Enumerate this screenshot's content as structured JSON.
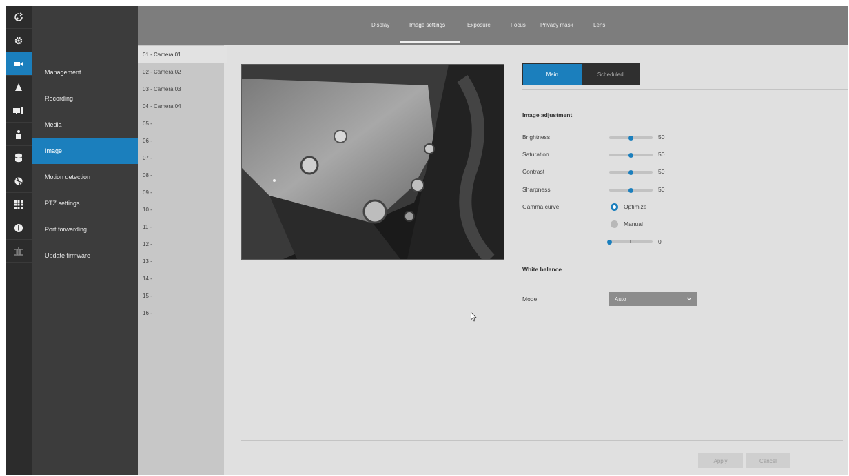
{
  "rail": {
    "items": [
      {
        "icon": "logout-icon"
      },
      {
        "icon": "gear-icon"
      },
      {
        "icon": "camera-icon",
        "active": true
      },
      {
        "icon": "alarm-icon"
      },
      {
        "icon": "monitor-icon"
      },
      {
        "icon": "user-icon"
      },
      {
        "icon": "database-icon"
      },
      {
        "icon": "network-icon"
      },
      {
        "icon": "grid-icon"
      },
      {
        "icon": "info-icon"
      },
      {
        "icon": "keyboard-icon"
      }
    ]
  },
  "menu": {
    "items": [
      {
        "label": "Management"
      },
      {
        "label": "Recording"
      },
      {
        "label": "Media"
      },
      {
        "label": "Image",
        "active": true
      },
      {
        "label": "Motion detection"
      },
      {
        "label": "PTZ settings"
      },
      {
        "label": "Port forwarding"
      },
      {
        "label": "Update firmware"
      }
    ]
  },
  "tabs": {
    "items": [
      {
        "label": "Display"
      },
      {
        "label": "Image settings",
        "active": true
      },
      {
        "label": "Exposure"
      },
      {
        "label": "Focus"
      },
      {
        "label": "Privacy mask"
      },
      {
        "label": "Lens"
      }
    ]
  },
  "cameras": {
    "items": [
      {
        "label": "01 - Camera 01",
        "active": true
      },
      {
        "label": "02 - Camera 02"
      },
      {
        "label": "03 - Camera 03"
      },
      {
        "label": "04 - Camera 04"
      },
      {
        "label": "05 -"
      },
      {
        "label": "06 -"
      },
      {
        "label": "07 -"
      },
      {
        "label": "08 -"
      },
      {
        "label": "09 -"
      },
      {
        "label": "10 -"
      },
      {
        "label": "11 -"
      },
      {
        "label": "12 -"
      },
      {
        "label": "13 -"
      },
      {
        "label": "14 -"
      },
      {
        "label": "15 -"
      },
      {
        "label": "16 -"
      }
    ]
  },
  "settings": {
    "mode_tabs": {
      "main": "Main",
      "scheduled": "Scheduled",
      "active": "Main"
    },
    "image_adjustment": {
      "title": "Image adjustment",
      "brightness": {
        "label": "Brightness",
        "value": "50",
        "level": 0.5
      },
      "saturation": {
        "label": "Saturation",
        "value": "50",
        "level": 0.5
      },
      "contrast": {
        "label": "Contrast",
        "value": "50",
        "level": 0.5
      },
      "sharpness": {
        "label": "Sharpness",
        "value": "50",
        "level": 0.5
      },
      "gamma": {
        "label": "Gamma curve",
        "option_optimize": "Optimize",
        "option_manual": "Manual",
        "selected": "Optimize",
        "manual_value": "0",
        "manual_level": 0.0
      }
    },
    "white_balance": {
      "title": "White balance",
      "mode_label": "Mode",
      "mode_value": "Auto"
    }
  },
  "actions": {
    "apply": "Apply",
    "cancel": "Cancel"
  },
  "colors": {
    "accent": "#1b7fbd",
    "rail": "#2c2c2c",
    "menu": "#3c3c3c",
    "topbar": "#7d7d7d"
  }
}
